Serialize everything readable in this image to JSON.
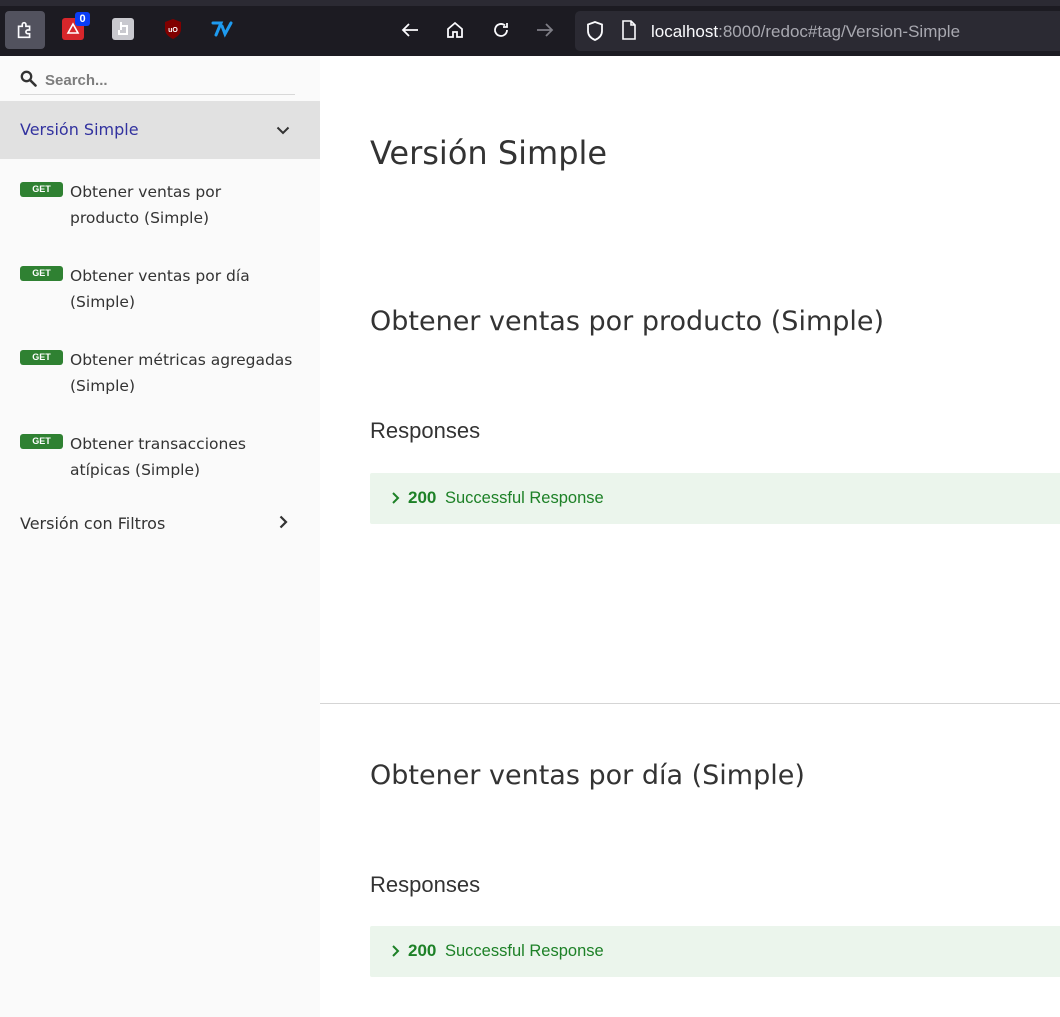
{
  "browser": {
    "extension_badge_count": "0",
    "url_host": "localhost",
    "url_rest": ":8000/redoc#tag/Version-Simple"
  },
  "sidebar": {
    "search_placeholder": "Search...",
    "active_group": "Versión Simple",
    "items": [
      {
        "method": "GET",
        "label": "Obtener ventas por producto (Simple)"
      },
      {
        "method": "GET",
        "label": "Obtener ventas por día (Simple)"
      },
      {
        "method": "GET",
        "label": "Obtener métricas agregadas (Simple)"
      },
      {
        "method": "GET",
        "label": "Obtener transacciones atípicas (Simple)"
      }
    ],
    "collapsed_group": "Versión con Filtros"
  },
  "main": {
    "tag_title": "Versión Simple",
    "operations": [
      {
        "title": "Obtener ventas por producto (Simple)",
        "responses_heading": "Responses",
        "response": {
          "code": "200",
          "description": "Successful Response"
        }
      },
      {
        "title": "Obtener ventas por día (Simple)",
        "responses_heading": "Responses",
        "response": {
          "code": "200",
          "description": "Successful Response"
        }
      }
    ]
  },
  "colors": {
    "accent": "#32329f",
    "get_badge": "#2f8132",
    "success_text": "#1d8127",
    "success_bg": "#ebf5ec"
  }
}
